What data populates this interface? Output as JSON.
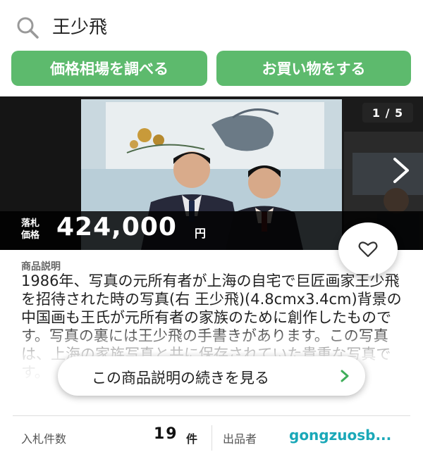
{
  "search": {
    "query": "王少飛"
  },
  "actions": {
    "price_lookup": "価格相場を調べる",
    "shop": "お買い物をする"
  },
  "gallery": {
    "page_indicator": "1 / 5"
  },
  "price": {
    "label_line1": "落札",
    "label_line2": "価格",
    "value": "424,000",
    "unit": "円"
  },
  "description": {
    "heading": "商品説明",
    "text": "1986年、写真の元所有者が上海の自宅で巨匠画家王少飛を招待された時の写真(右 王少飛)(4.8cmx3.4cm)背景の中国画も王氏が元所有者の家族のために創作したものです。写真の裏には王少飛の手書きがあります。この写真は、上海の家族写真と共に保存されていた貴重な写真です。",
    "more_button": "この商品説明の続きを見る"
  },
  "stats": {
    "bids_label": "入札件数",
    "bids_count": "19",
    "bids_unit": "件",
    "seller_label": "出品者",
    "seller_name": "gongzuosb..."
  },
  "colors": {
    "accent_green": "#5dba6d",
    "seller_link": "#1aa8b8"
  }
}
